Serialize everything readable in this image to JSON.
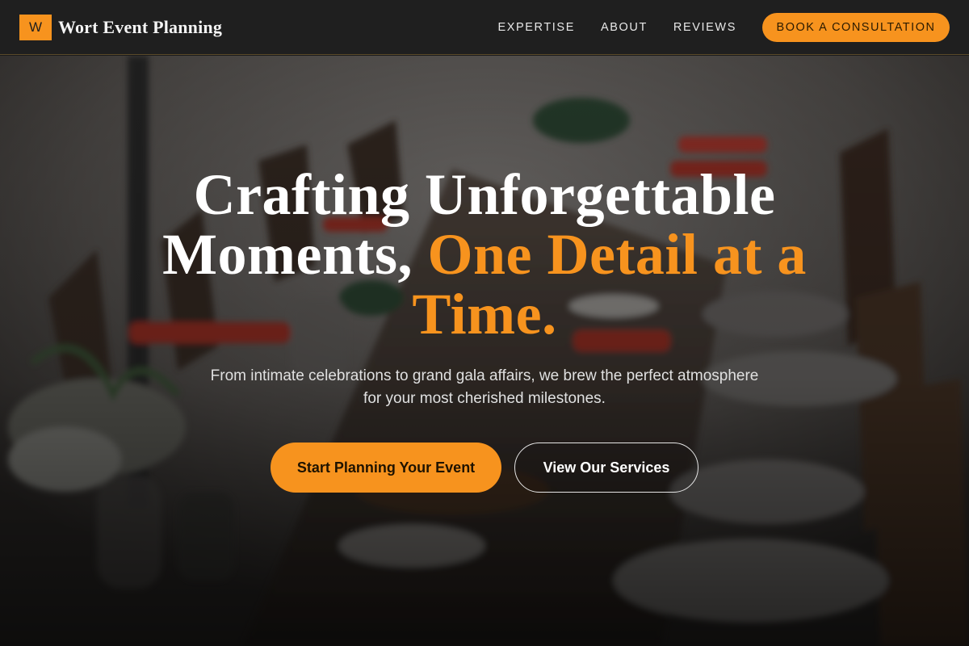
{
  "brand": {
    "logo_letter": "W",
    "name": "Wort Event Planning"
  },
  "nav": {
    "links": [
      "EXPERTISE",
      "ABOUT",
      "REVIEWS"
    ],
    "cta_label": "BOOK A CONSULTATION"
  },
  "hero": {
    "headline_part1": "Crafting Unforgettable Moments, ",
    "headline_accent": "One Detail at a Time.",
    "subtext": "From intimate celebrations to grand gala affairs, we brew the perfect atmosphere for your most cherished milestones.",
    "primary_button": "Start Planning Your Event",
    "secondary_button": "View Our Services",
    "background_icon": "dining-table-photo"
  },
  "colors": {
    "accent": "#f7931e",
    "nav_background": "#1f1f1f"
  }
}
